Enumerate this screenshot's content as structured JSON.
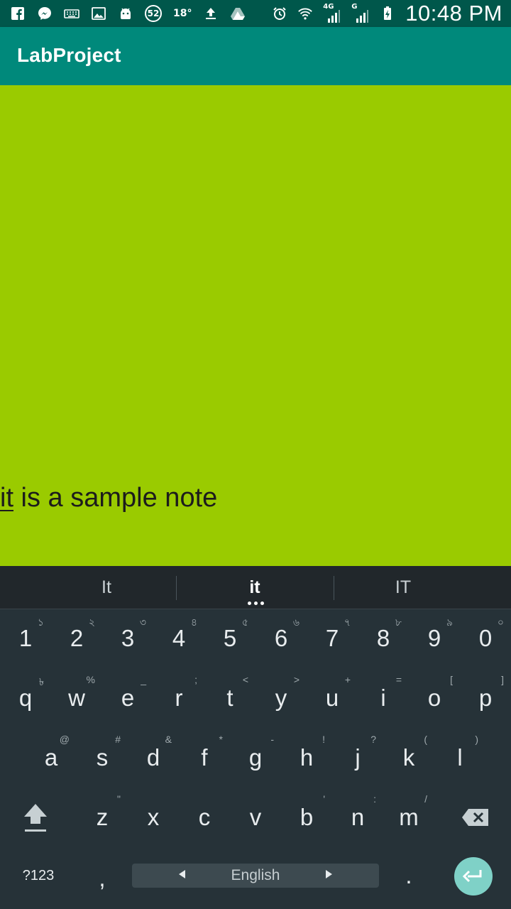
{
  "status_bar": {
    "notification_count": "52",
    "temperature": "18°",
    "network_4g": "4G",
    "network_g": "G",
    "time": "10:48 PM"
  },
  "toolbar": {
    "title": "LabProject"
  },
  "note": {
    "first_word": "it",
    "rest": " is a sample note"
  },
  "keyboard": {
    "suggestions": [
      "It",
      "it",
      "IT"
    ],
    "row1": [
      {
        "key": "1",
        "hint": "১"
      },
      {
        "key": "2",
        "hint": "২"
      },
      {
        "key": "3",
        "hint": "৩"
      },
      {
        "key": "4",
        "hint": "৪"
      },
      {
        "key": "5",
        "hint": "৫"
      },
      {
        "key": "6",
        "hint": "৬"
      },
      {
        "key": "7",
        "hint": "৭"
      },
      {
        "key": "8",
        "hint": "৮"
      },
      {
        "key": "9",
        "hint": "৯"
      },
      {
        "key": "0",
        "hint": "০"
      }
    ],
    "row2": [
      {
        "key": "q",
        "hint": "৳"
      },
      {
        "key": "w",
        "hint": "%"
      },
      {
        "key": "e",
        "hint": "_"
      },
      {
        "key": "r",
        "hint": ";"
      },
      {
        "key": "t",
        "hint": "<"
      },
      {
        "key": "y",
        "hint": ">"
      },
      {
        "key": "u",
        "hint": "+"
      },
      {
        "key": "i",
        "hint": "="
      },
      {
        "key": "o",
        "hint": "["
      },
      {
        "key": "p",
        "hint": "]"
      }
    ],
    "row3": [
      {
        "key": "a",
        "hint": "@"
      },
      {
        "key": "s",
        "hint": "#"
      },
      {
        "key": "d",
        "hint": "&"
      },
      {
        "key": "f",
        "hint": "*"
      },
      {
        "key": "g",
        "hint": "-"
      },
      {
        "key": "h",
        "hint": "!"
      },
      {
        "key": "j",
        "hint": "?"
      },
      {
        "key": "k",
        "hint": "("
      },
      {
        "key": "l",
        "hint": ")"
      }
    ],
    "row4": [
      {
        "key": "z",
        "hint": "\""
      },
      {
        "key": "x",
        "hint": ""
      },
      {
        "key": "c",
        "hint": ""
      },
      {
        "key": "v",
        "hint": ""
      },
      {
        "key": "b",
        "hint": "'"
      },
      {
        "key": "n",
        "hint": ":"
      },
      {
        "key": "m",
        "hint": "/"
      }
    ],
    "symbols_label": "?123",
    "comma": ",",
    "space_label": "English",
    "period": "."
  }
}
